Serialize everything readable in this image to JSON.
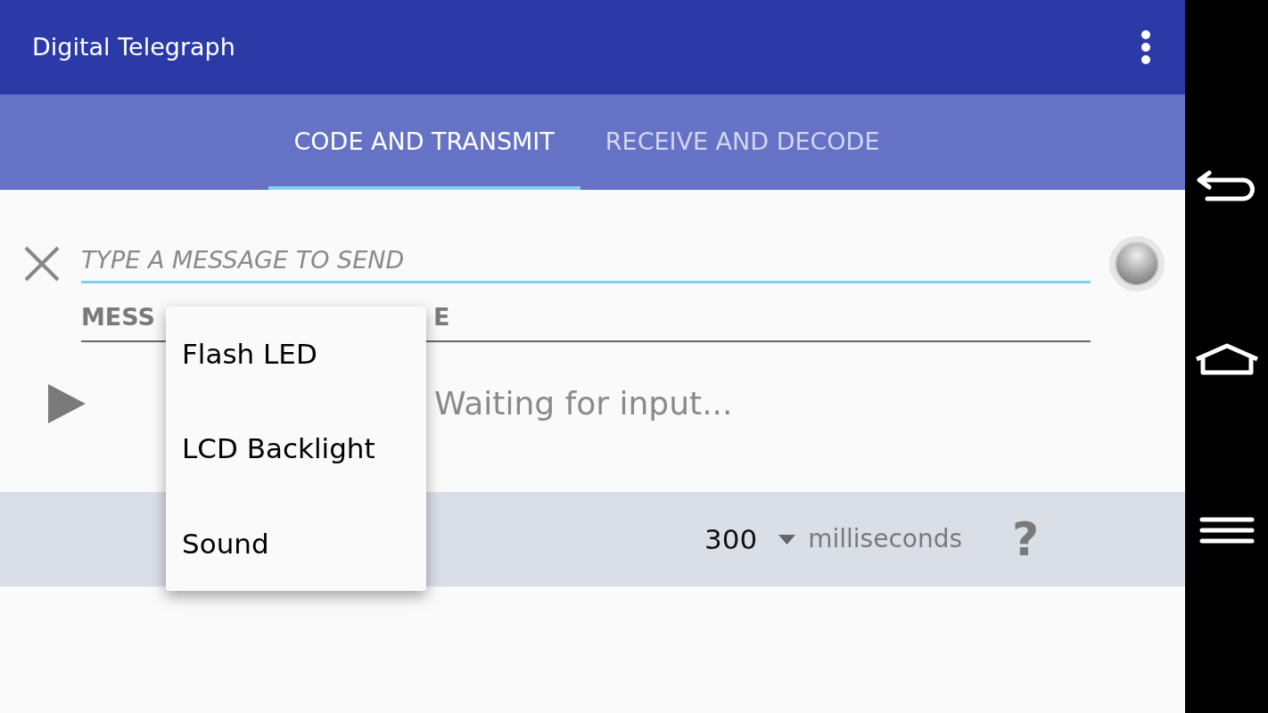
{
  "app_bar": {
    "title": "Digital Telegraph"
  },
  "tabs": [
    {
      "label": "CODE AND TRANSMIT",
      "selected": true
    },
    {
      "label": "RECEIVE AND DECODE",
      "selected": false
    }
  ],
  "message_field": {
    "placeholder": "TYPE A MESSAGE TO SEND"
  },
  "morse_field": {
    "label_visible_parts": [
      "MESS",
      "E"
    ]
  },
  "status": "Waiting for input...",
  "timing": {
    "value": "300",
    "unit": "milliseconds",
    "help": "?"
  },
  "popup_menu": [
    {
      "label": "Flash LED"
    },
    {
      "label": "LCD Backlight"
    },
    {
      "label": "Sound"
    }
  ]
}
